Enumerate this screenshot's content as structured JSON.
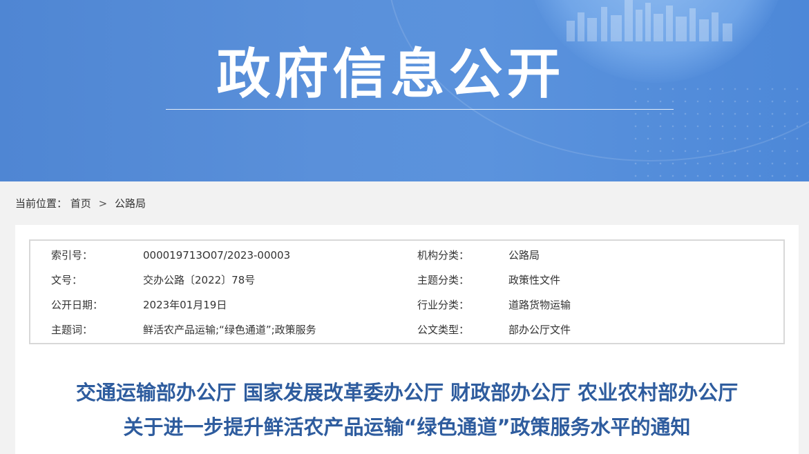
{
  "banner": {
    "title": "政府信息公开"
  },
  "breadcrumb": {
    "prefix": "当前位置：",
    "home": "首页",
    "separator": ">",
    "current": "公路局"
  },
  "meta": {
    "rows": [
      {
        "label1": "索引号：",
        "value1": "000019713O07/2023-00003",
        "label2": "机构分类：",
        "value2": "公路局"
      },
      {
        "label1": "文号：",
        "value1": "交办公路〔2022〕78号",
        "label2": "主题分类：",
        "value2": "政策性文件"
      },
      {
        "label1": "公开日期：",
        "value1": "2023年01月19日",
        "label2": "行业分类：",
        "value2": "道路货物运输"
      },
      {
        "label1": "主题词：",
        "value1": "鲜活农产品运输;“绿色通道”;政策服务",
        "label2": "公文类型：",
        "value2": "部办公厅文件"
      }
    ]
  },
  "document": {
    "title_line1": "交通运输部办公厅 国家发展改革委办公厅 财政部办公厅 农业农村部办公厅",
    "title_line2": "关于进一步提升鲜活农产品运输“绿色通道”政策服务水平的通知"
  },
  "colors": {
    "banner": "#5a90da",
    "title": "#2e5c9e",
    "background": "#f2f2f2"
  }
}
